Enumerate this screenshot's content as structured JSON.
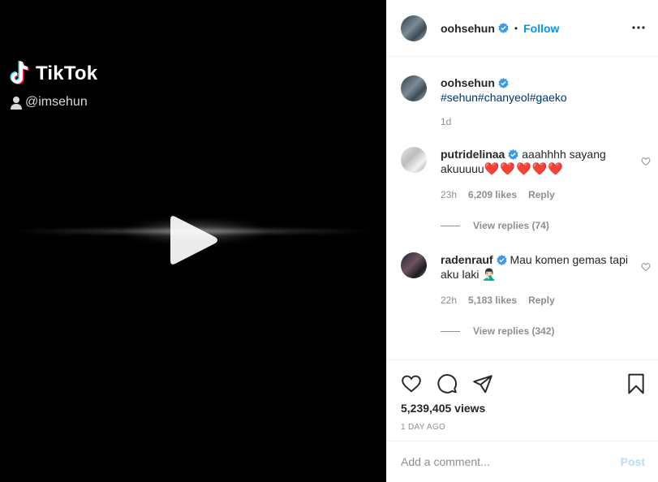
{
  "video": {
    "watermark_brand": "TikTok",
    "watermark_user": "@imsehun"
  },
  "header": {
    "username": "oohsehun",
    "dot": "•",
    "follow_label": "Follow"
  },
  "caption": {
    "author": "oohsehun",
    "hashtags": "#sehun#chanyeol#gaeko",
    "time": "1d"
  },
  "comments": [
    {
      "author": "putridelinaa",
      "text": "aaahhhh sayang akuuuuu",
      "hearts": "❤️❤️❤️❤️❤️",
      "time": "23h",
      "likes": "6,209 likes",
      "reply_label": "Reply",
      "view_replies": "View replies (74)"
    },
    {
      "author": "radenrauf",
      "text": "Mau komen gemas tapi aku laki",
      "emoji": "🤦🏻‍♂️",
      "time": "22h",
      "likes": "5,183 likes",
      "reply_label": "Reply",
      "view_replies": "View replies (342)"
    }
  ],
  "stats": {
    "views": "5,239,405 views",
    "posted": "1 DAY AGO"
  },
  "add_comment": {
    "placeholder": "Add a comment...",
    "post_label": "Post"
  },
  "colors": {
    "link_blue": "#0095f6",
    "hashtag_blue": "#00376b",
    "muted_gray": "#8e8e8e",
    "post_disabled": "#b2dffc"
  }
}
